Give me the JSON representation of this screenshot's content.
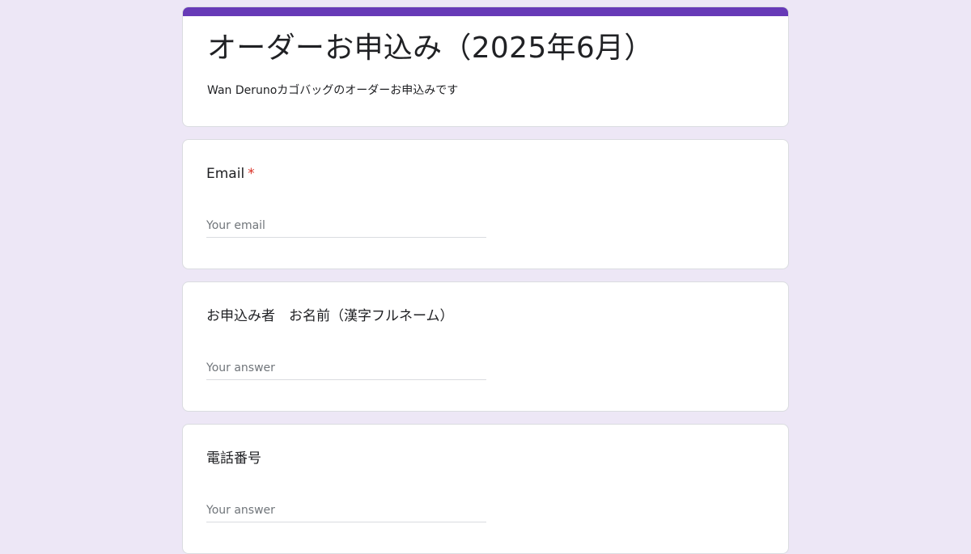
{
  "form": {
    "title": "オーダーお申込み（2025年6月）",
    "description": "Wan Derunoカゴバッグのオーダーお申込みです",
    "accent_color": "#673ab7",
    "background_color": "#ede7f6"
  },
  "questions": [
    {
      "label": "Email",
      "required_mark": "*",
      "placeholder": "Your email"
    },
    {
      "label": "お申込み者　お名前（漢字フルネーム）",
      "placeholder": "Your answer"
    },
    {
      "label": "電話番号",
      "placeholder": "Your answer"
    }
  ]
}
